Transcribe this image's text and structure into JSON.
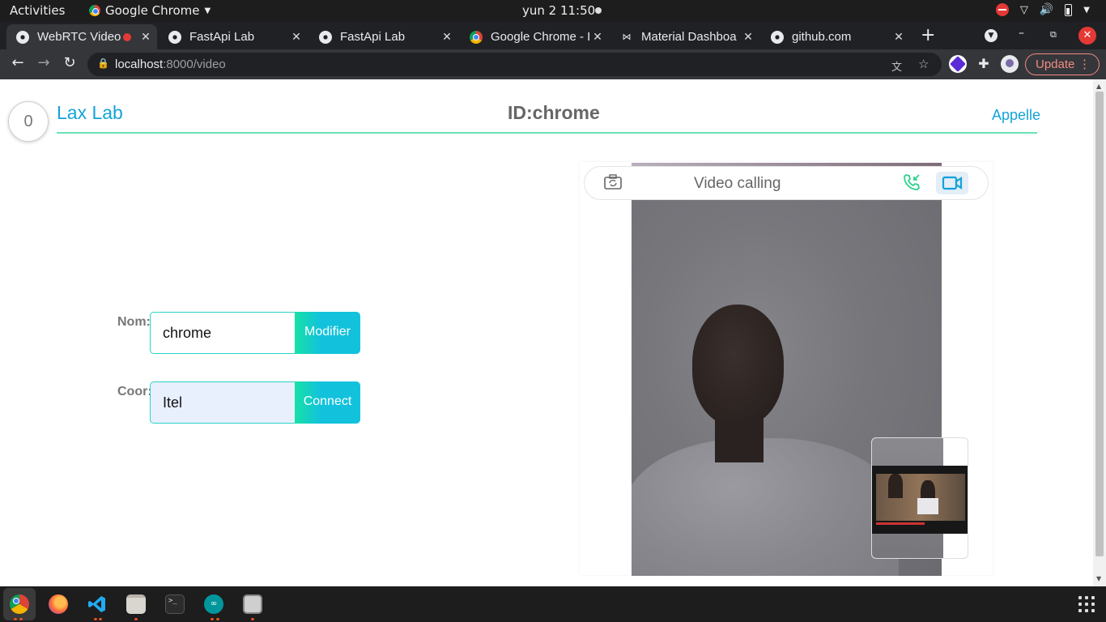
{
  "topbar": {
    "activities": "Activities",
    "app_name": "Google Chrome",
    "clock": "yun 2  11:50"
  },
  "tabs": [
    {
      "title": "WebRTC Video",
      "icon": "globe-icon",
      "recording": true,
      "active": true
    },
    {
      "title": "FastApi Lab",
      "icon": "globe-icon"
    },
    {
      "title": "FastApi Lab",
      "icon": "globe-icon"
    },
    {
      "title": "Google Chrome - D",
      "icon": "chrome-icon"
    },
    {
      "title": "Material Dashboa",
      "icon": "material-icon"
    },
    {
      "title": "github.com",
      "icon": "globe-icon"
    }
  ],
  "toolbar": {
    "url_host": "localhost",
    "url_path": ":8000/video",
    "update_label": "Update"
  },
  "page": {
    "counter": "0",
    "brand": "Lax Lab",
    "id_text": "ID:chrome",
    "appelle": "Appelle",
    "form": {
      "nom_label": "Nom:",
      "nom_value": "chrome",
      "modifier_label": "Modifier",
      "coor_label": "Coor:",
      "coor_value": "Itel",
      "connect_label": "Connect"
    },
    "call": {
      "title": "Video calling"
    }
  },
  "colors": {
    "accent": "#14a3d9",
    "divider": "#69e3b4",
    "button_gradient_start": "#17e0a7",
    "button_gradient_end": "#12c2dc",
    "call_accept": "#2cd38b",
    "update_text": "#f28b82"
  }
}
